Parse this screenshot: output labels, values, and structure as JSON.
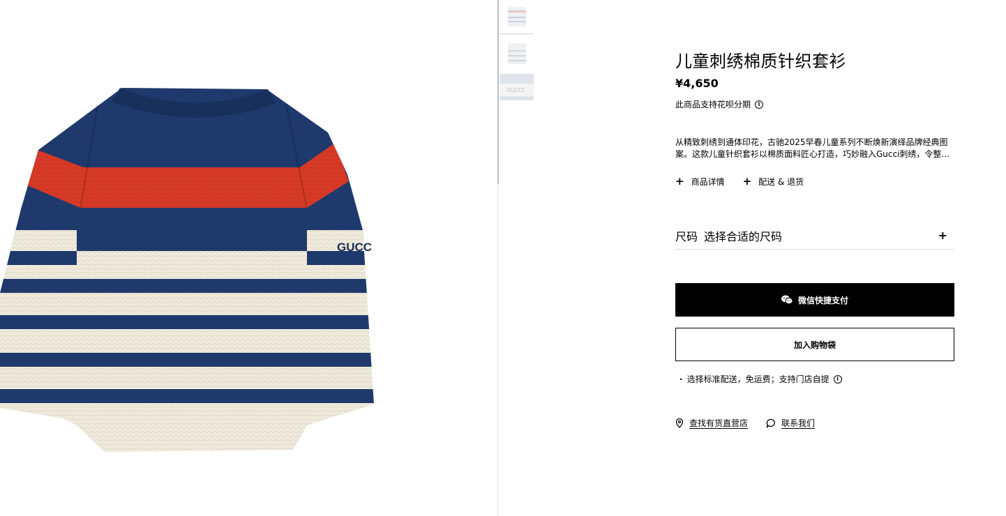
{
  "product": {
    "title": "儿童刺绣棉质针织套衫",
    "price": "¥4,650",
    "installment_text": "此商品支持花呗分期",
    "description_line1": "从精致刺绣到通体印花，古驰2025早春儿童系列不断焕新演绎品牌经典图",
    "description_line2": "案。这款儿童针织套衫以棉质面料匠心打造，巧妙融入Gucci刺绣，令整...",
    "sleeve_embroidery": "GUCC"
  },
  "links": {
    "details_label": "商品详情",
    "shipping_label": "配送 & 退货"
  },
  "size": {
    "label": "尺码",
    "placeholder": "选择合适的尺码"
  },
  "buttons": {
    "wechat_pay": "微信快捷支付",
    "add_to_bag": "加入购物袋"
  },
  "delivery_note": "选择标准配送，免运费；支持门店自提",
  "bottom": {
    "find_store": "查找有货直营店",
    "contact": "联系我们"
  },
  "thumbnail_logo": "GUCCI",
  "colors": {
    "navy": "#1f3a6e",
    "red": "#d73a26",
    "cream": "#efeadb",
    "black": "#000000"
  },
  "icons": {
    "info": "info-icon",
    "plus": "plus-icon",
    "wechat": "wechat-icon",
    "location": "location-pin-icon",
    "chat": "chat-bubble-icon"
  }
}
